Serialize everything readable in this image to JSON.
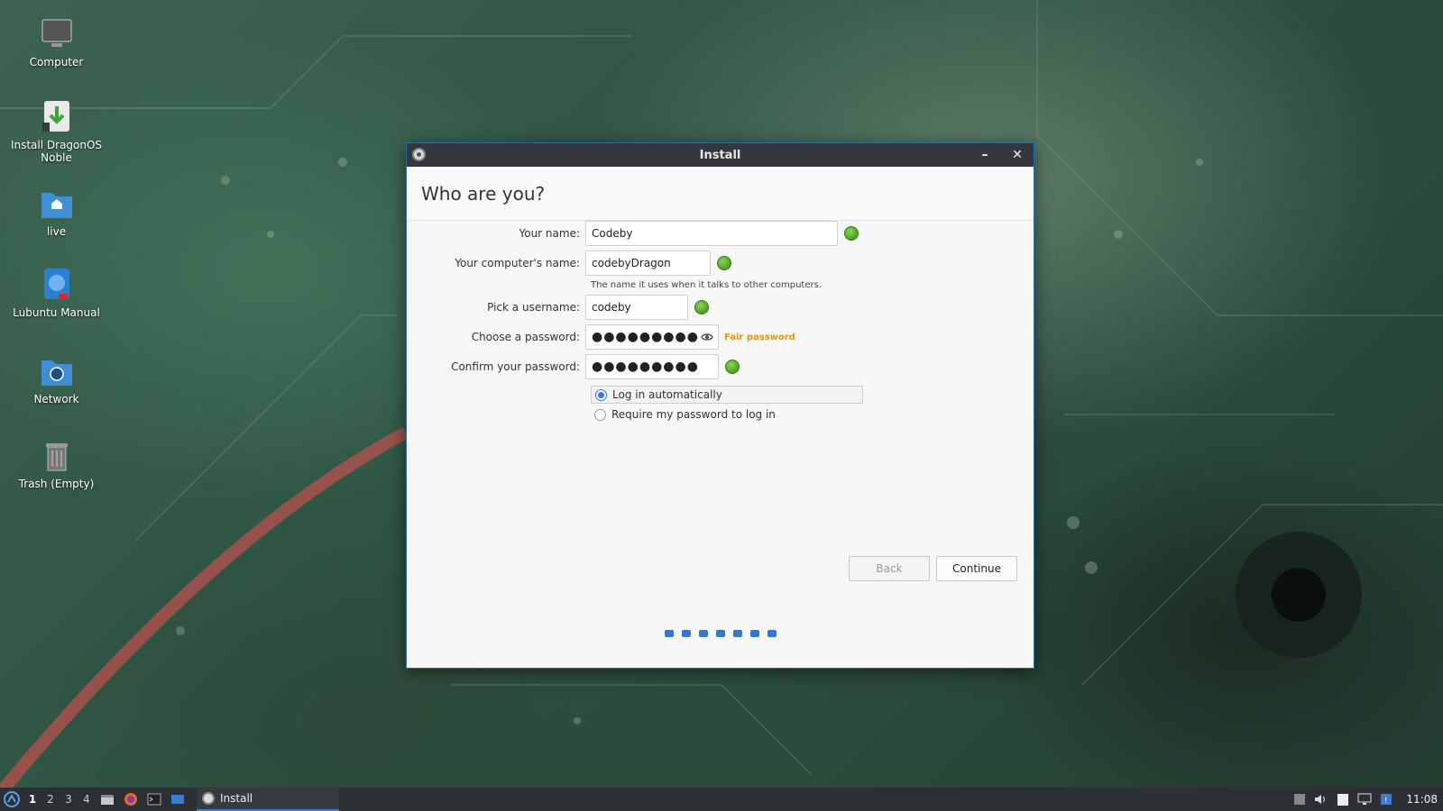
{
  "desktop": {
    "icons": [
      {
        "label": "Computer"
      },
      {
        "label": "Install DragonOS Noble"
      },
      {
        "label": "live"
      },
      {
        "label": "Lubuntu Manual"
      },
      {
        "label": "Network"
      },
      {
        "label": "Trash (Empty)"
      }
    ]
  },
  "window": {
    "title": "Install",
    "minimize_glyph": "–",
    "close_glyph": "✕",
    "heading": "Who are you?",
    "form": {
      "name_label": "Your name:",
      "name_value": "Codeby",
      "computer_label": "Your computer's name:",
      "computer_value": "codebyDragon",
      "computer_hint": "The name it uses when it talks to other computers.",
      "username_label": "Pick a username:",
      "username_value": "codeby",
      "password_label": "Choose a password:",
      "password_value": "●●●●●●●●●",
      "password_strength": "Fair password",
      "confirm_label": "Confirm your password:",
      "confirm_value": "●●●●●●●●●",
      "login_auto": "Log in automatically",
      "login_require": "Require my password to log in"
    },
    "buttons": {
      "back": "Back",
      "continue": "Continue"
    },
    "steps_count": 7
  },
  "taskbar": {
    "workspaces": [
      "1",
      "2",
      "3",
      "4"
    ],
    "task_label": "Install",
    "clock": "11:08"
  },
  "colors": {
    "accent": "#3a7bd5",
    "ok": "#4aa021",
    "strength": "#e0961a",
    "titlebar": "#34373c",
    "taskbar": "#2c2f33"
  }
}
